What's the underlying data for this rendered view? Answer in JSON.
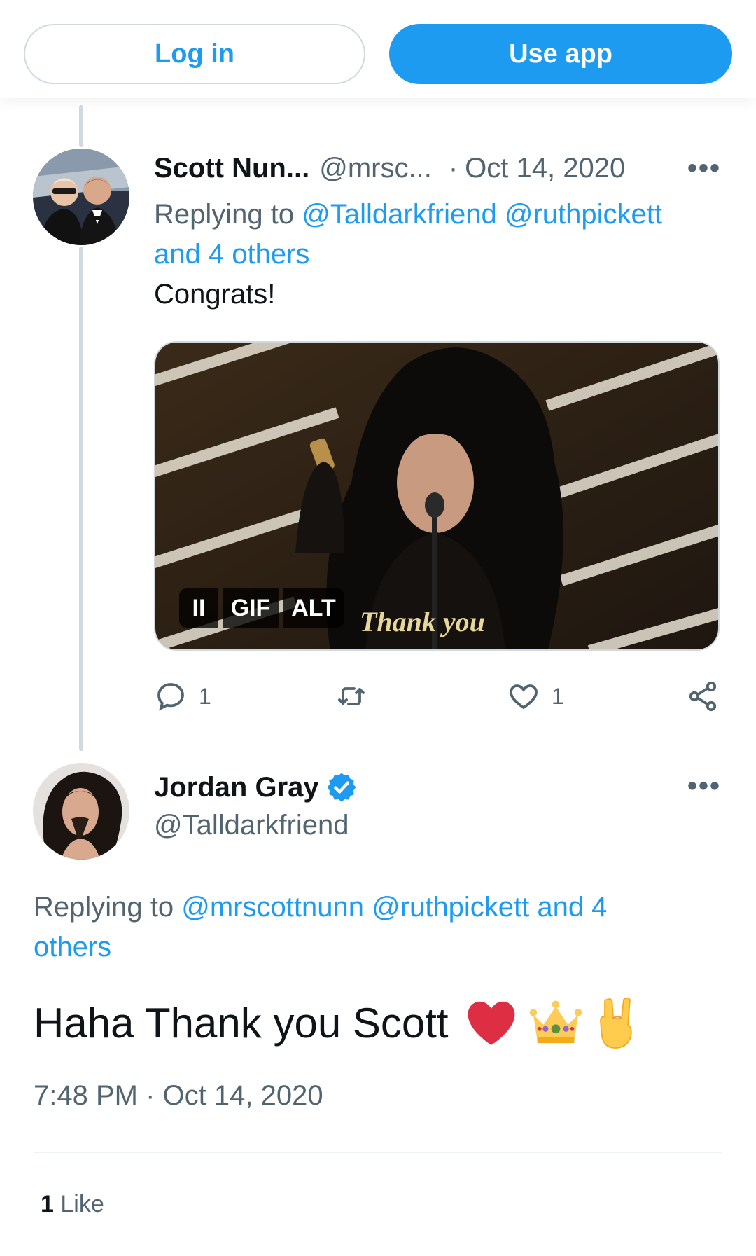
{
  "topbar": {
    "login_label": "Log in",
    "app_label": "Use app"
  },
  "reply_tweet": {
    "author_name": "Scott Nun...",
    "author_handle": "@mrsc...",
    "separator": "·",
    "date": "Oct 14, 2020",
    "more_label": "•••",
    "replying_prefix": "Replying to",
    "replying_link_1": "@Talldarkfriend",
    "replying_link_2": "@ruthpickett",
    "replying_more": "and 4 others",
    "text": "Congrats!",
    "media": {
      "caption": "Thank you",
      "pause_label": "II",
      "gif_label": "GIF",
      "alt_label": "ALT"
    },
    "actions": {
      "reply_count": "1",
      "like_count": "1"
    }
  },
  "main_tweet": {
    "author_name": "Jordan Gray",
    "author_handle": "@Talldarkfriend",
    "more_label": "•••",
    "replying_prefix": "Replying to",
    "replying_link_1": "@mrscottnunn",
    "replying_link_2": "@ruthpickett and 4",
    "replying_link_3": "others",
    "text": "Haha Thank you Scott",
    "emojis": [
      "heart-emoji",
      "crown-emoji",
      "rock-hand-emoji"
    ],
    "time": "7:48 PM",
    "separator": "·",
    "date": "Oct 14, 2020",
    "likes_count": "1",
    "likes_label": "Like"
  },
  "colors": {
    "accent": "#1d9bf0",
    "text": "#0f1419",
    "muted": "#536471",
    "border": "#cfd9de",
    "verified": "#1d9bf0"
  }
}
